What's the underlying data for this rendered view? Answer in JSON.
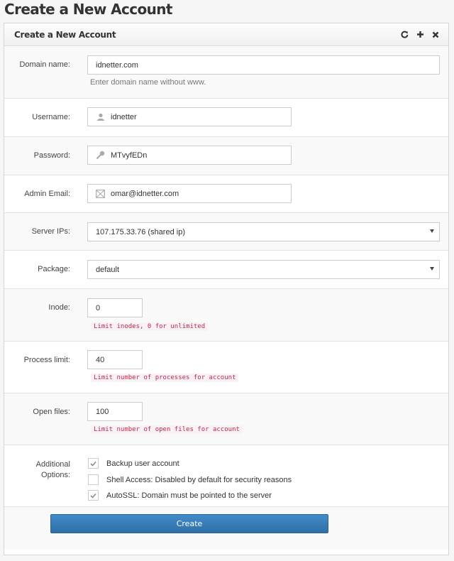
{
  "page": {
    "title": "Create a New Account"
  },
  "panel": {
    "title": "Create a New Account",
    "icons": [
      "refresh-icon",
      "plus-icon",
      "close-icon"
    ]
  },
  "form": {
    "domain": {
      "label": "Domain name:",
      "value": "idnetter.com",
      "help": "Enter domain name without www."
    },
    "username": {
      "label": "Username:",
      "value": "idnetter",
      "icon": "user-icon"
    },
    "password": {
      "label": "Password:",
      "value": "MTvyfEDn",
      "icon": "key-icon"
    },
    "email": {
      "label": "Admin Email:",
      "value": "omar@idnetter.com",
      "icon": "envelope-icon"
    },
    "server_ips": {
      "label": "Server IPs:",
      "selected": "107.175.33.76 (shared ip)"
    },
    "package": {
      "label": "Package:",
      "selected": "default"
    },
    "inode": {
      "label": "Inode:",
      "value": "0",
      "help": "Limit inodes, 0 for unlimited"
    },
    "process_limit": {
      "label": "Process limit:",
      "value": "40",
      "help": "Limit number of processes for account"
    },
    "open_files": {
      "label": "Open files:",
      "value": "100",
      "help": "Limit number of open files for account"
    },
    "options": {
      "label_line1": "Additional",
      "label_line2": "Options:",
      "items": [
        {
          "label": "Backup user account",
          "checked": true
        },
        {
          "label": "Shell Access: Disabled by default for security reasons",
          "checked": false
        },
        {
          "label": "AutoSSL: Domain must be pointed to the server",
          "checked": true
        }
      ]
    },
    "submit_label": "Create"
  }
}
